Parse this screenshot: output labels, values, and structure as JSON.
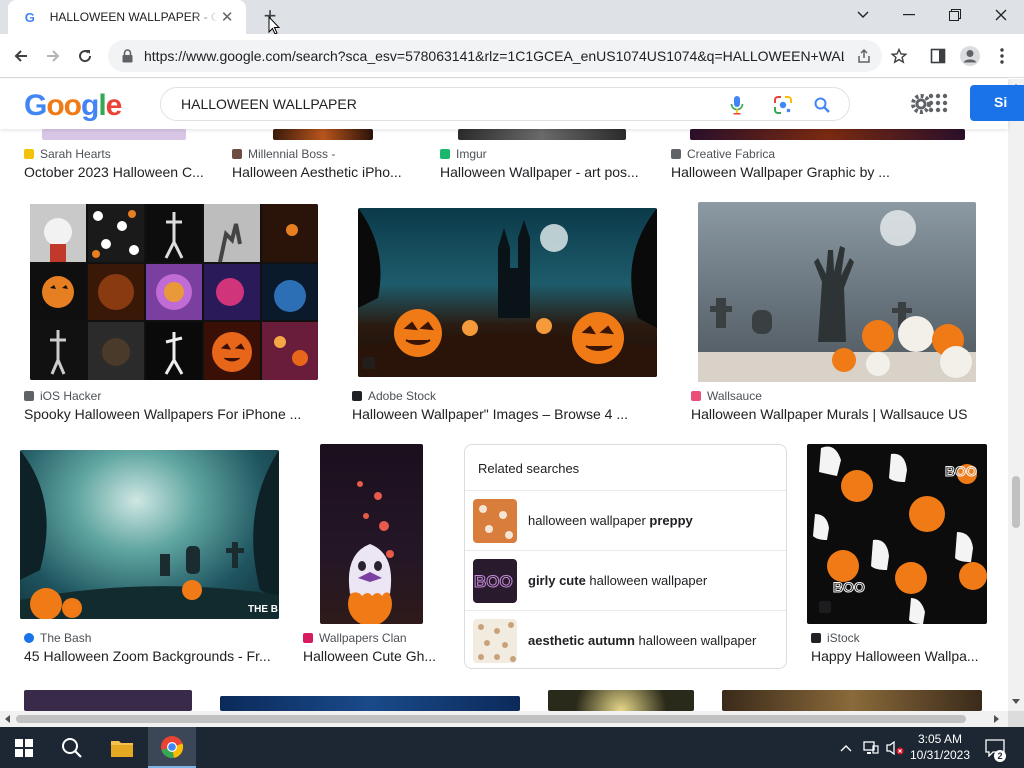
{
  "browser": {
    "tab_title": "HALLOWEEN WALLPAPER - Google Search",
    "tab_favicon": "G",
    "new_tab_symbol": "+",
    "url": "https://www.google.com/search?sca_esv=578063141&rlz=1C1GCEA_enUS1074US1074&q=HALLOWEEN+WALLPAPER&tbm=isch"
  },
  "google": {
    "logo_letters": [
      "G",
      "o",
      "o",
      "g",
      "l",
      "e"
    ],
    "logo_colors": [
      "#4285f4",
      "#f07a16",
      "#f07a16",
      "#4285f4",
      "#34a853",
      "#ea4335"
    ],
    "query": "HALLOWEEN WALLPAPER",
    "signin_label": "Si"
  },
  "results": {
    "row1": [
      {
        "source": "Sarah Hearts",
        "title": "October 2023 Halloween C...",
        "icon_color": "#f4c20d"
      },
      {
        "source": "Millennial Boss -",
        "title": "Halloween Aesthetic iPho...",
        "icon_color": "#6d4c41"
      },
      {
        "source": "Imgur",
        "title": "Halloween Wallpaper - art pos...",
        "icon_color": "#1bb76e"
      },
      {
        "source": "Creative Fabrica",
        "title": "Halloween Wallpaper Graphic by ...",
        "icon_color": "#5f6368"
      }
    ],
    "row2": [
      {
        "source": "iOS Hacker",
        "title": "Spooky Halloween Wallpapers For iPhone ...",
        "icon_color": "#5f6368"
      },
      {
        "source": "Adobe Stock",
        "title": "Halloween Wallpaper\" Images – Browse 4 ...",
        "icon_color": "#202124"
      },
      {
        "source": "Wallsauce",
        "title": "Halloween Wallpaper Murals | Wallsauce US",
        "icon_color": "#e94e77"
      }
    ],
    "row3": [
      {
        "source": "The Bash",
        "title": "45 Halloween Zoom Backgrounds - Fr...",
        "icon_color": "#1a73e8"
      },
      {
        "source": "Wallpapers Clan",
        "title": "Halloween Cute Gh...",
        "icon_color": "#d81b60"
      },
      {
        "source": "iStock",
        "title": "Happy Halloween Wallpa...",
        "icon_color": "#202124"
      }
    ],
    "thumb_watermark": "THE B"
  },
  "related": {
    "heading": "Related searches",
    "items": [
      {
        "pre": "halloween wallpaper ",
        "bold": "preppy",
        "post": ""
      },
      {
        "pre": "",
        "bold": "girly cute",
        "post": " halloween wallpaper"
      },
      {
        "pre": "",
        "bold": "aesthetic autumn",
        "post": " halloween wallpaper"
      }
    ],
    "thumb_text_2": "BOO"
  },
  "taskbar": {
    "time": "3:05 AM",
    "date": "10/31/2023",
    "notifications": "2"
  }
}
